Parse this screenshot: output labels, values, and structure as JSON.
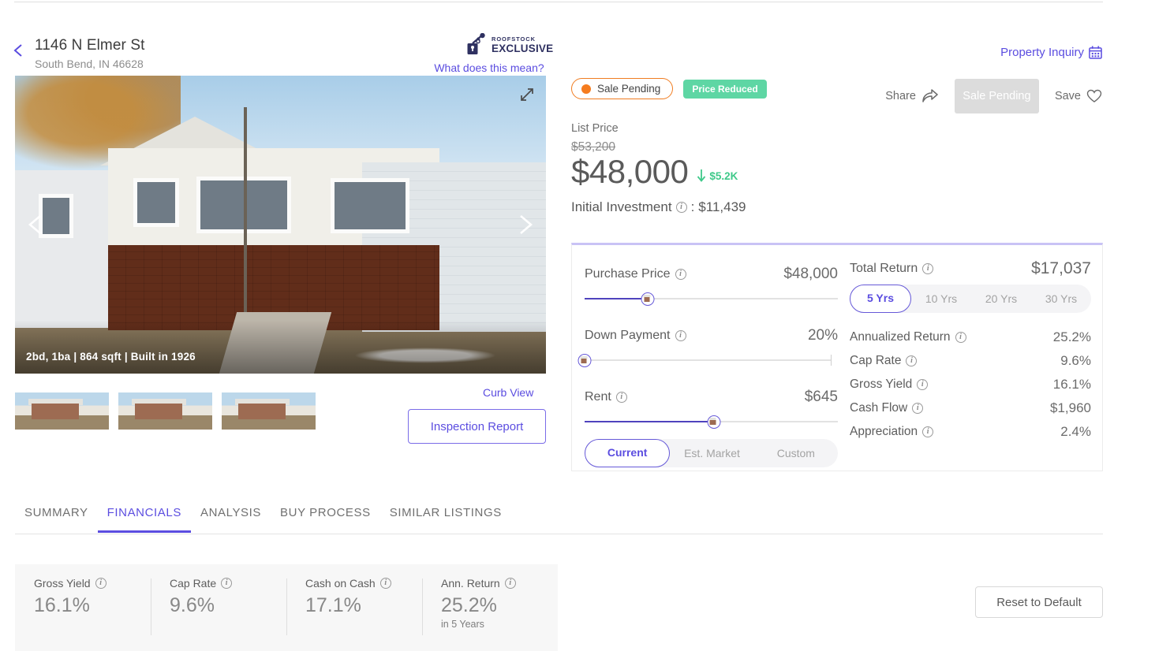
{
  "header": {
    "back_icon": "chevron-left-icon",
    "address_line1": "1146 N Elmer St",
    "address_line2": "South Bend, IN 46628",
    "logo_top": "ROOFSTOCK",
    "logo_bottom": "EXCLUSIVE",
    "what_does_this_mean": "What does this mean?",
    "property_inquiry": "Property Inquiry",
    "calendar_icon": "calendar-icon"
  },
  "gallery": {
    "caption": "2bd, 1ba | 864 sqft | Built in 1926",
    "prev_icon": "chevron-left-icon",
    "next_icon": "chevron-right-icon",
    "expand_icon": "expand-diagonal-icon",
    "thumbnail_count": 3
  },
  "actions": {
    "curb_view": "Curb View",
    "inspection_report": "Inspection Report",
    "share": "Share",
    "share_icon": "share-arrow-icon",
    "sale_pending_button": "Sale Pending",
    "save": "Save",
    "save_icon": "heart-outline-icon"
  },
  "badges": {
    "status": "Sale Pending",
    "status_dot_color": "#f57c1f",
    "status_border_color": "#f07c20",
    "price_reduced": "Price Reduced",
    "price_reduced_bg": "#5ed6a4"
  },
  "price": {
    "label": "List Price",
    "original": "$53,200",
    "current": "$48,000",
    "delta": "$5.2K",
    "delta_direction": "down",
    "delta_color": "#3fc98a",
    "initial_investment_label": "Initial Investment",
    "initial_investment_separator": ":",
    "initial_investment_value": "$11,439"
  },
  "calculator": {
    "accent_color": "#5b4de0",
    "inputs": [
      {
        "label": "Purchase Price",
        "value": "$48,000",
        "slider_percent": 25,
        "has_end_tick": false
      },
      {
        "label": "Down Payment",
        "value": "20%",
        "slider_percent": 0,
        "has_end_tick": true
      },
      {
        "label": "Rent",
        "value": "$645",
        "slider_percent": 51,
        "has_end_tick": false
      }
    ],
    "rent_segments": [
      {
        "label": "Current",
        "active": true
      },
      {
        "label": "Est. Market",
        "active": false
      },
      {
        "label": "Custom",
        "active": false
      }
    ],
    "total_return_label": "Total Return",
    "total_return_value": "$17,037",
    "year_segments": [
      {
        "label": "5 Yrs",
        "active": true
      },
      {
        "label": "10 Yrs",
        "active": false
      },
      {
        "label": "20 Yrs",
        "active": false
      },
      {
        "label": "30 Yrs",
        "active": false
      }
    ],
    "metrics": [
      {
        "label": "Annualized Return",
        "value": "25.2%"
      },
      {
        "label": "Cap Rate",
        "value": "9.6%"
      },
      {
        "label": "Gross Yield",
        "value": "16.1%"
      },
      {
        "label": "Cash Flow",
        "value": "$1,960"
      },
      {
        "label": "Appreciation",
        "value": "2.4%"
      }
    ]
  },
  "tabs": [
    {
      "label": "SUMMARY",
      "active": false
    },
    {
      "label": "FINANCIALS",
      "active": true
    },
    {
      "label": "ANALYSIS",
      "active": false
    },
    {
      "label": "BUY PROCESS",
      "active": false
    },
    {
      "label": "SIMILAR LISTINGS",
      "active": false
    }
  ],
  "metric_strip": [
    {
      "label": "Gross Yield",
      "value": "16.1%",
      "sub": ""
    },
    {
      "label": "Cap Rate",
      "value": "9.6%",
      "sub": ""
    },
    {
      "label": "Cash on Cash",
      "value": "17.1%",
      "sub": ""
    },
    {
      "label": "Ann. Return",
      "value": "25.2%",
      "sub": "in 5 Years"
    }
  ],
  "reset_button": "Reset to Default"
}
